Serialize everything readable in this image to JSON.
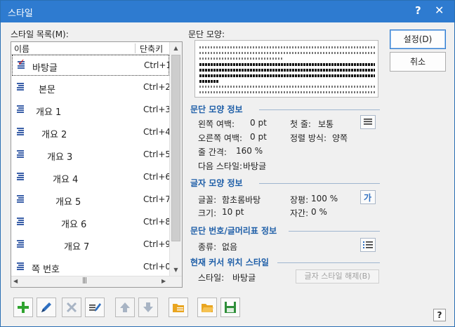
{
  "dialog": {
    "title": "스타일",
    "help_glyph": "?",
    "close_glyph": "✕"
  },
  "style_list": {
    "label": "스타일 목록(M):",
    "col_name": "이름",
    "col_key": "단축키",
    "items": [
      {
        "name": "바탕글",
        "key": "Ctrl+1",
        "selected": true
      },
      {
        "name": "본문",
        "key": "Ctrl+2"
      },
      {
        "name": "개요 1",
        "key": "Ctrl+3"
      },
      {
        "name": "개요 2",
        "key": "Ctrl+4"
      },
      {
        "name": "개요 3",
        "key": "Ctrl+5"
      },
      {
        "name": "개요 4",
        "key": "Ctrl+6"
      },
      {
        "name": "개요 5",
        "key": "Ctrl+7"
      },
      {
        "name": "개요 6",
        "key": "Ctrl+8"
      },
      {
        "name": "개요 7",
        "key": "Ctrl+9"
      },
      {
        "name": "쪽 번호",
        "key": "Ctrl+0"
      }
    ]
  },
  "preview": {
    "label": "문단 모양:"
  },
  "buttons": {
    "ok": "설정(D)",
    "cancel": "취소"
  },
  "para_shape": {
    "title": "문단 모양 정보",
    "left_margin_label": "왼쪽 여백:",
    "left_margin_value": "0 pt",
    "first_line_label": "첫 줄:",
    "first_line_value": "보통",
    "right_margin_label": "오른쪽 여백:",
    "right_margin_value": "0 pt",
    "align_label": "정렬 방식:",
    "align_value": "양쪽",
    "line_spacing_label": "줄 간격:",
    "line_spacing_value": "160 %",
    "next_style_label": "다음 스타일:",
    "next_style_value": "바탕글"
  },
  "char_shape": {
    "title": "글자 모양 정보",
    "font_label": "글꼴:",
    "font_value": "함초롬바탕",
    "width_label": "장평:",
    "width_value": "100 %",
    "size_label": "크기:",
    "size_value": "10 pt",
    "spacing_label": "자간:",
    "spacing_value": "0 %",
    "icon_glyph": "가"
  },
  "numbering": {
    "title": "문단 번호/글머리표 정보",
    "type_label": "종류:",
    "type_value": "없음"
  },
  "cursor_style": {
    "title": "현재 커서 위치 스타일",
    "style_label": "스타일:",
    "style_value": "바탕글",
    "release_button": "글자 스타일 해제(B)"
  },
  "toolbar": {
    "help_glyph": "?"
  },
  "colors": {
    "titlebar": "#2e7bd0",
    "section_title": "#1f5fa8",
    "add_icon": "#2fa32f",
    "edit_icon": "#2e6fc0",
    "folder_icon": "#e9a520",
    "save_icon": "#2f8f3a"
  }
}
